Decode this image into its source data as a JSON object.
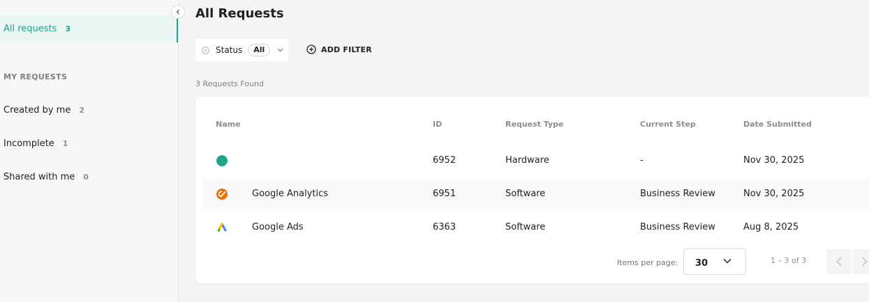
{
  "sidebar": {
    "active": {
      "label": "All requests",
      "count": "3"
    },
    "section_title": "MY REQUESTS",
    "items": [
      {
        "label": "Created by me",
        "count": "2"
      },
      {
        "label": "Incomplete",
        "count": "1"
      },
      {
        "label": "Shared with me",
        "count": "0"
      }
    ]
  },
  "header": {
    "title": "All Requests"
  },
  "filters": {
    "status_label": "Status",
    "status_value": "All",
    "add_filter_label": "ADD FILTER"
  },
  "results": {
    "found_text": "3 Requests Found"
  },
  "table": {
    "columns": [
      "Name",
      "ID",
      "Request Type",
      "Current Step",
      "Date Submitted"
    ],
    "rows": [
      {
        "icon": "green-dot-icon",
        "name": "",
        "id": "6952",
        "type": "Hardware",
        "step": "-",
        "date": "Nov 30, 2025"
      },
      {
        "icon": "google-analytics-icon",
        "name": "Google Analytics",
        "id": "6951",
        "type": "Software",
        "step": "Business Review",
        "date": "Nov 30, 2025"
      },
      {
        "icon": "google-ads-icon",
        "name": "Google Ads",
        "id": "6363",
        "type": "Software",
        "step": "Business Review",
        "date": "Aug 8, 2025"
      }
    ]
  },
  "pagination": {
    "items_per_page_label": "Items per page:",
    "items_per_page_value": "30",
    "range_text": "1 – 3 of 3"
  },
  "colors": {
    "accent": "#1fa68a",
    "analytics": "#e8710a",
    "ads_blue": "#4285f4",
    "ads_yellow": "#fbbc04",
    "ads_green": "#34a853"
  }
}
